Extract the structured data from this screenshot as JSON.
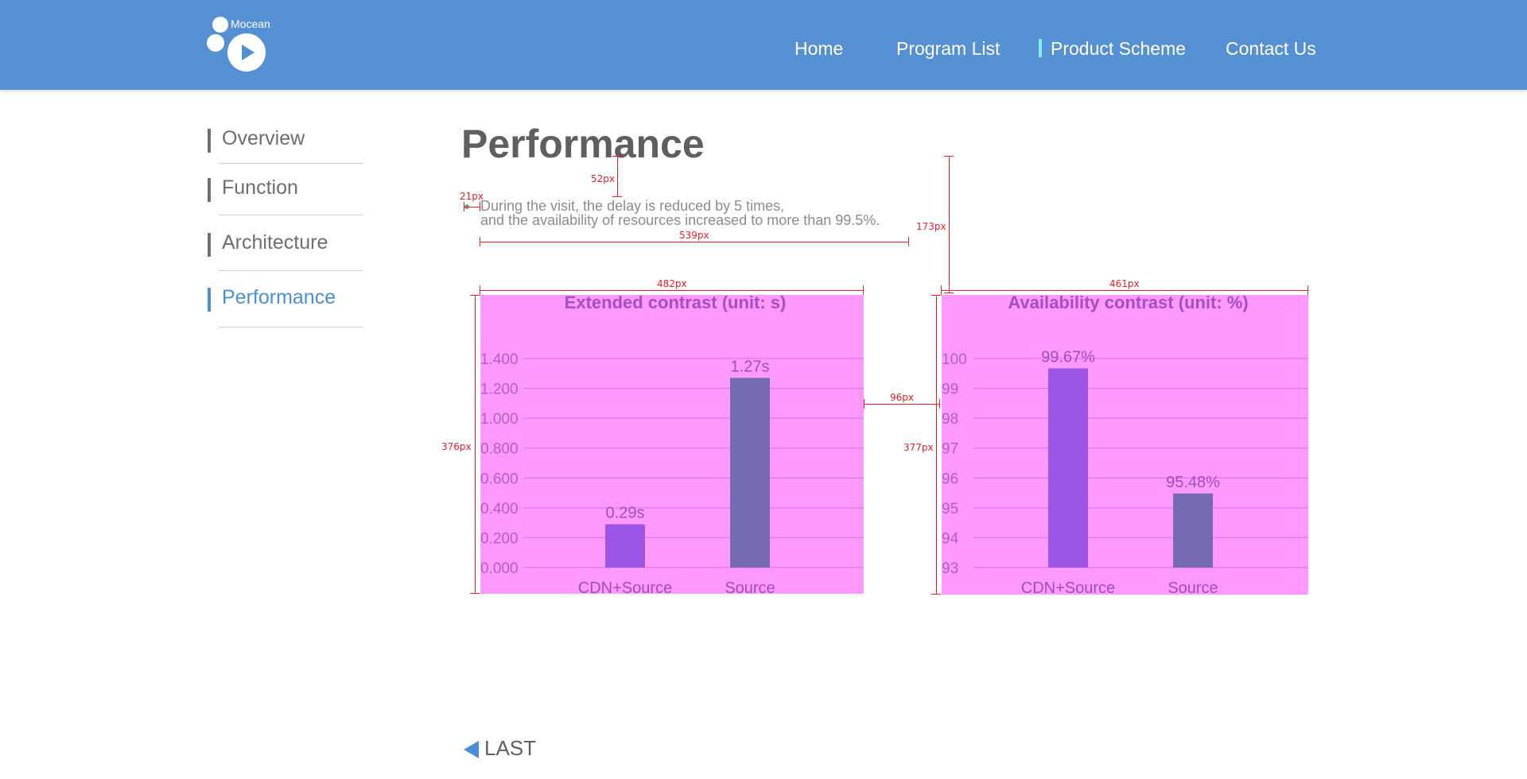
{
  "header": {
    "logo_text": "Mocean",
    "nav": [
      {
        "label": "Home"
      },
      {
        "label": "Program List"
      },
      {
        "label": "Product Scheme"
      },
      {
        "label": "Contact Us"
      }
    ],
    "active_nav_index": 2,
    "colors": {
      "background": "#5591d2",
      "active_marker": "#7ff0f0"
    }
  },
  "sidebar": {
    "items": [
      {
        "label": "Overview"
      },
      {
        "label": "Function"
      },
      {
        "label": "Architecture"
      },
      {
        "label": "Performance"
      }
    ],
    "active_index": 3,
    "colors": {
      "default": "#6e6e6e",
      "active": "#4a8fd6"
    }
  },
  "main": {
    "title": "Performance",
    "description": [
      "During the visit, the delay is reduced by 5 times,",
      "and the availability of resources increased to more than 99.5%."
    ],
    "last_link": "LAST"
  },
  "measurements": {
    "labels": [
      "21px",
      "52px",
      "173px",
      "539px",
      "482px",
      "461px",
      "96px",
      "376px",
      "377px"
    ],
    "color": "#e8202a"
  },
  "chart_data": [
    {
      "type": "bar",
      "title": "Extended contrast (unit: s)",
      "categories": [
        "CDN+Source",
        "Source"
      ],
      "values": [
        0.29,
        1.27
      ],
      "data_labels": [
        "0.29s",
        "1.27s"
      ],
      "ylim": [
        0,
        1.4
      ],
      "yticks": [
        "0.000",
        "0.200",
        "0.400",
        "0.600",
        "0.800",
        "1.000",
        "1.200",
        "1.400"
      ],
      "grid": true,
      "bar_colors": [
        "#9b57e3",
        "#766bb3"
      ],
      "background": "#ff99ff"
    },
    {
      "type": "bar",
      "title": "Availability contrast (unit: %)",
      "categories": [
        "CDN+Source",
        "Source"
      ],
      "values": [
        99.67,
        95.48
      ],
      "data_labels": [
        "99.67%",
        "95.48%"
      ],
      "ylim": [
        93,
        100
      ],
      "yticks": [
        "93",
        "94",
        "95",
        "96",
        "97",
        "98",
        "99",
        "100"
      ],
      "grid": true,
      "bar_colors": [
        "#9b57e3",
        "#766bb3"
      ],
      "background": "#ff99ff"
    }
  ]
}
